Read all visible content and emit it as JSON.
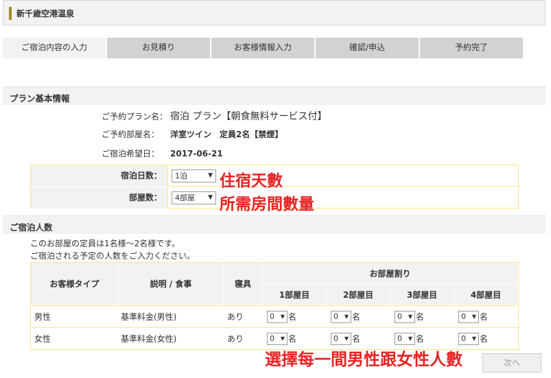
{
  "header": {
    "title": "新千歳空港温泉"
  },
  "steps": [
    {
      "label": "ご宿泊内容の入力",
      "active": true
    },
    {
      "label": "お見積り",
      "active": false
    },
    {
      "label": "お客様情報入力",
      "active": false
    },
    {
      "label": "確認/申込",
      "active": false
    },
    {
      "label": "予約完了",
      "active": false
    }
  ],
  "plan_section": {
    "title": "プラン基本情報",
    "plan_label": "ご予約プラン名：",
    "plan_value": "宿泊 プラン【朝食無料サービス付】",
    "room_label": "ご予約部屋名：",
    "room_value": "洋室ツイン　定員2名【禁煙】",
    "date_label": "ご宿泊希望日：",
    "date_value": "2017-06-21"
  },
  "form": {
    "nights_label": "宿泊日数：",
    "nights_value": "1泊",
    "rooms_label": "部屋数：",
    "rooms_value": "4部屋"
  },
  "annotations": {
    "nights_note": "住宿天數",
    "rooms_note": "所需房間數量",
    "guests_note": "選擇每一間男性跟女性人數"
  },
  "guests_section": {
    "title": "ご宿泊人数",
    "capacity_text": "このお部屋の定員は1名様～2名様です。",
    "instruction_text": "ご宿泊される予定の人数をご入力ください。"
  },
  "room_table": {
    "col_type": "お客様タイプ",
    "col_desc": "説明 / 食事",
    "col_bedding": "寝具",
    "col_allocation": "お部屋割り",
    "room_headers": [
      "1部屋目",
      "2部屋目",
      "3部屋目",
      "4部屋目"
    ],
    "unit": "名",
    "rows": [
      {
        "type": "男性",
        "desc": "基準料金(男性)",
        "bedding": "あり",
        "counts": [
          "0",
          "0",
          "0",
          "0"
        ]
      },
      {
        "type": "女性",
        "desc": "基準料金(女性)",
        "bedding": "あり",
        "counts": [
          "0",
          "0",
          "0",
          "0"
        ]
      }
    ]
  },
  "next_button": {
    "label": "次へ"
  }
}
